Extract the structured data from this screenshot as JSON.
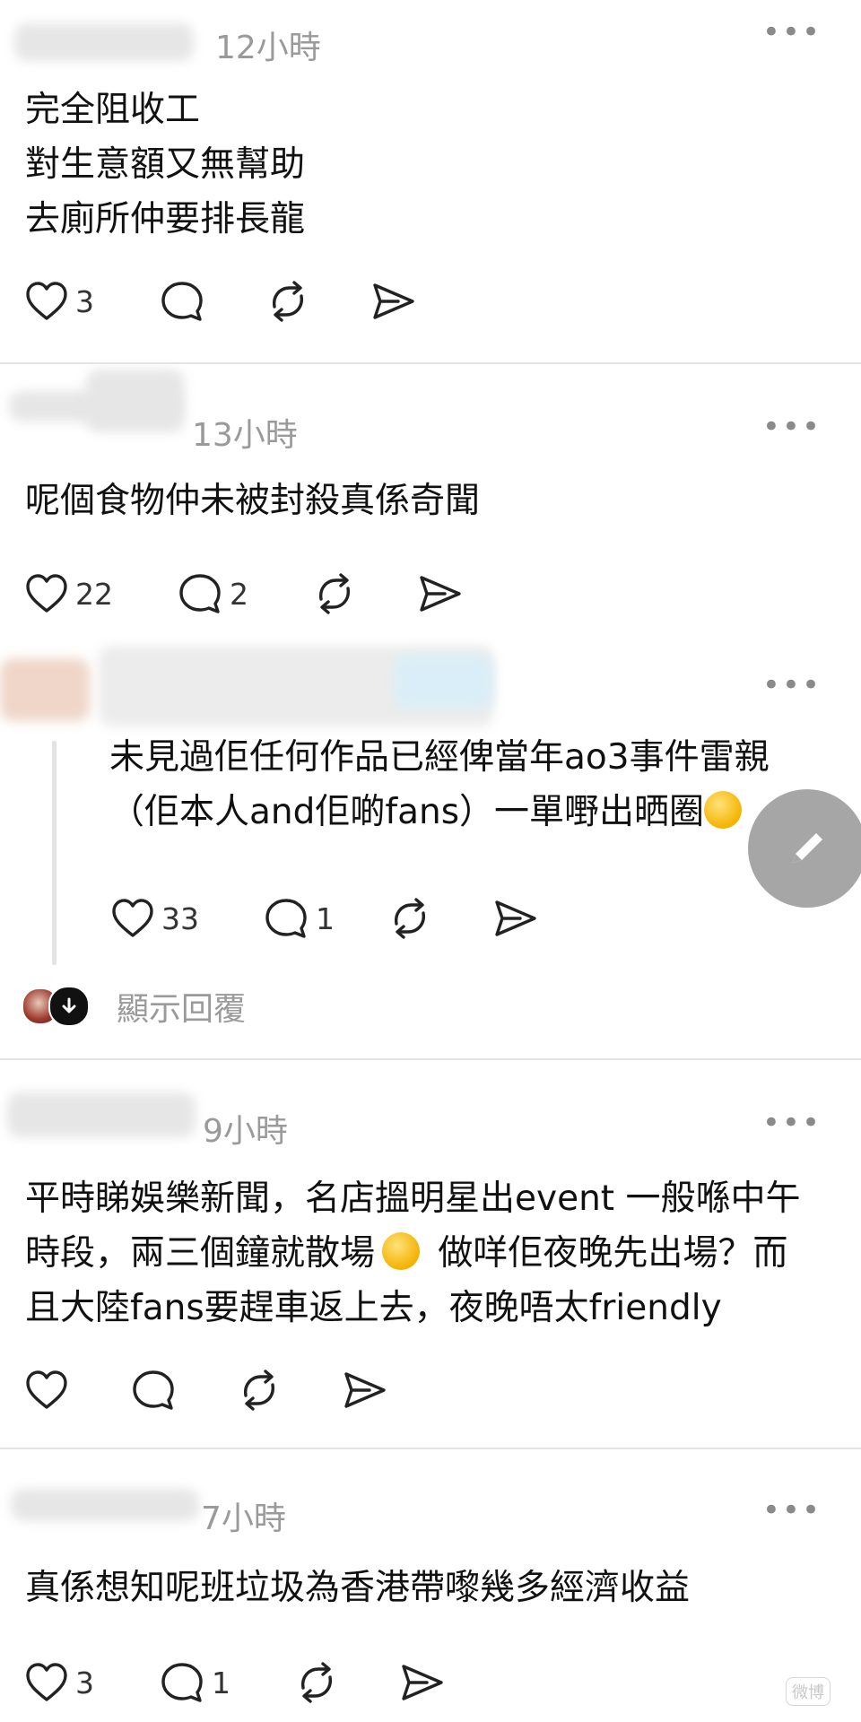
{
  "posts": [
    {
      "time": "12小時",
      "lines": [
        "完全阻收工",
        "對生意額又無幫助",
        "去廁所仲要排長龍"
      ],
      "likes": "3",
      "replies": "",
      "more": "•••"
    },
    {
      "time": "13小時",
      "lines": [
        "呢個食物仲未被封殺真係奇聞"
      ],
      "likes": "22",
      "replies": "2",
      "more": "•••"
    },
    {
      "time": "",
      "lines": [
        "未見過佢任何作品已經俾當年ao3事件雷親",
        "（佢本人and佢啲fans）一單嘢出晒圈"
      ],
      "likes": "33",
      "replies": "1",
      "more": "•••",
      "show_replies": "顯示回覆"
    },
    {
      "time": "9小時",
      "lines": [
        "平時睇娛樂新聞，名店搵明星出event 一般喺中午",
        "時段，兩三個鐘就散場",
        " 做咩佢夜晚先出場？而",
        "且大陸fans要趕車返上去，夜晚唔太friendly"
      ],
      "likes": "",
      "replies": "",
      "more": "•••"
    },
    {
      "time": "7小時",
      "lines": [
        "真係想知呢班垃圾為香港帶嚟幾多經濟收益"
      ],
      "likes": "3",
      "replies": "1",
      "more": "•••"
    }
  ],
  "icons": {
    "like": "heart-icon",
    "reply": "comment-icon",
    "repost": "repost-icon",
    "share": "share-icon",
    "compose": "pencil-icon"
  },
  "watermark": "微博"
}
